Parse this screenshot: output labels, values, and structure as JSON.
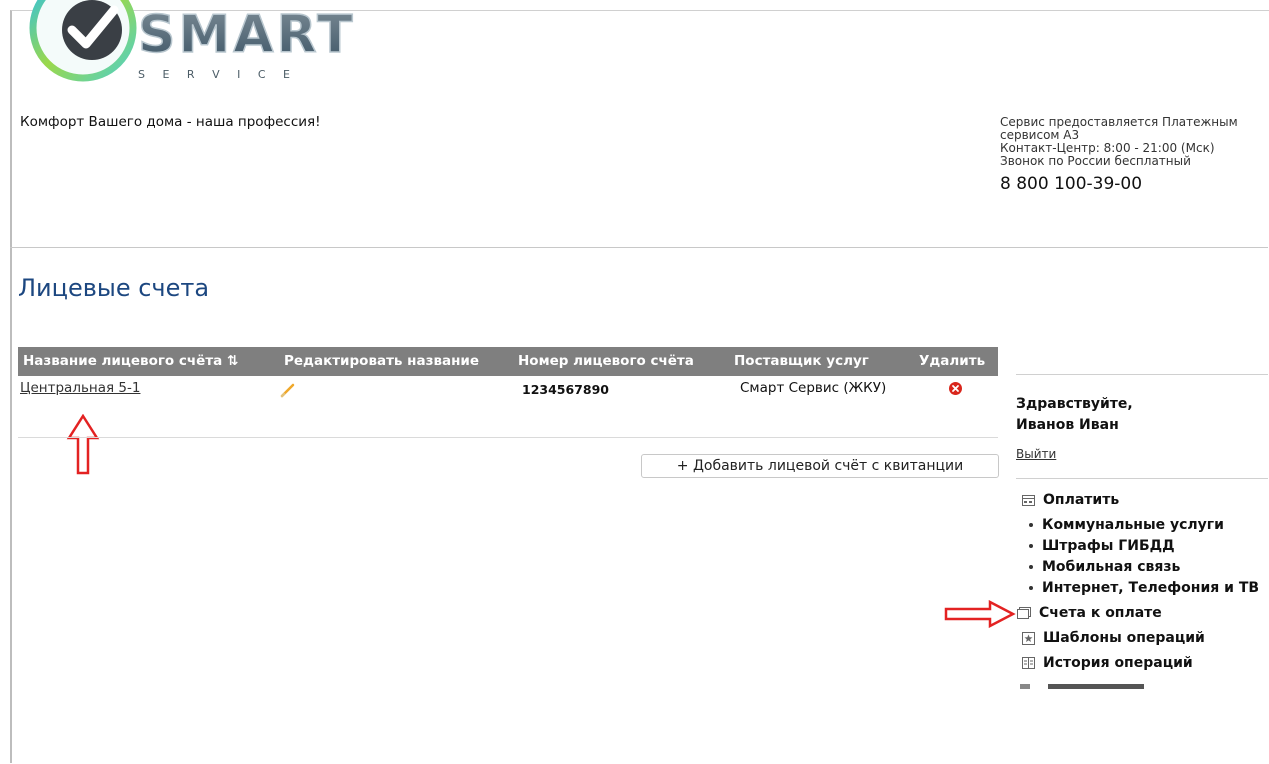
{
  "brand": {
    "name": "SMART",
    "subtitle": "S E R V I C E"
  },
  "header": {
    "tagline": "Комфорт Вашего дома - наша профессия!",
    "service_info": {
      "line1": "Сервис предоставляется Платежным сервисом А3",
      "line2": "Контакт-Центр: 8:00 - 21:00 (Мск)",
      "line3": "Звонок по России бесплатный",
      "phone": "8 800 100-39-00"
    }
  },
  "main": {
    "title": "Лицевые счета",
    "table": {
      "columns": [
        "Название лицевого счёта ⇅",
        "Редактировать название",
        "Номер лицевого счёта",
        "Поставщик услуг",
        "Удалить"
      ],
      "rows": [
        {
          "name": "Центральная 5-1",
          "number": "1234567890",
          "provider": "Смарт Сервис (ЖКУ)"
        }
      ]
    },
    "add_button": "+ Добавить лицевой счёт с квитанции"
  },
  "sidebar": {
    "greeting": "Здравствуйте,",
    "user_name": "Иванов Иван",
    "logout": "Выйти",
    "menu": {
      "pay": "Оплатить",
      "pay_items": [
        "Коммунальные услуги",
        "Штрафы ГИБДД",
        "Мобильная связь",
        "Интернет, Телефония и ТВ"
      ],
      "bills": "Счета к оплате",
      "templates": "Шаблоны операций",
      "history": "История операций"
    }
  },
  "colors": {
    "title_blue": "#1c4780",
    "table_header": "#7f7f7f",
    "arrow_red": "#e32222",
    "delete_red": "#d9261c"
  },
  "icons": [
    "checkmark-logo-icon",
    "edit-pencil-icon",
    "delete-icon",
    "card-icon",
    "bills-icon",
    "star-icon",
    "history-icon"
  ]
}
